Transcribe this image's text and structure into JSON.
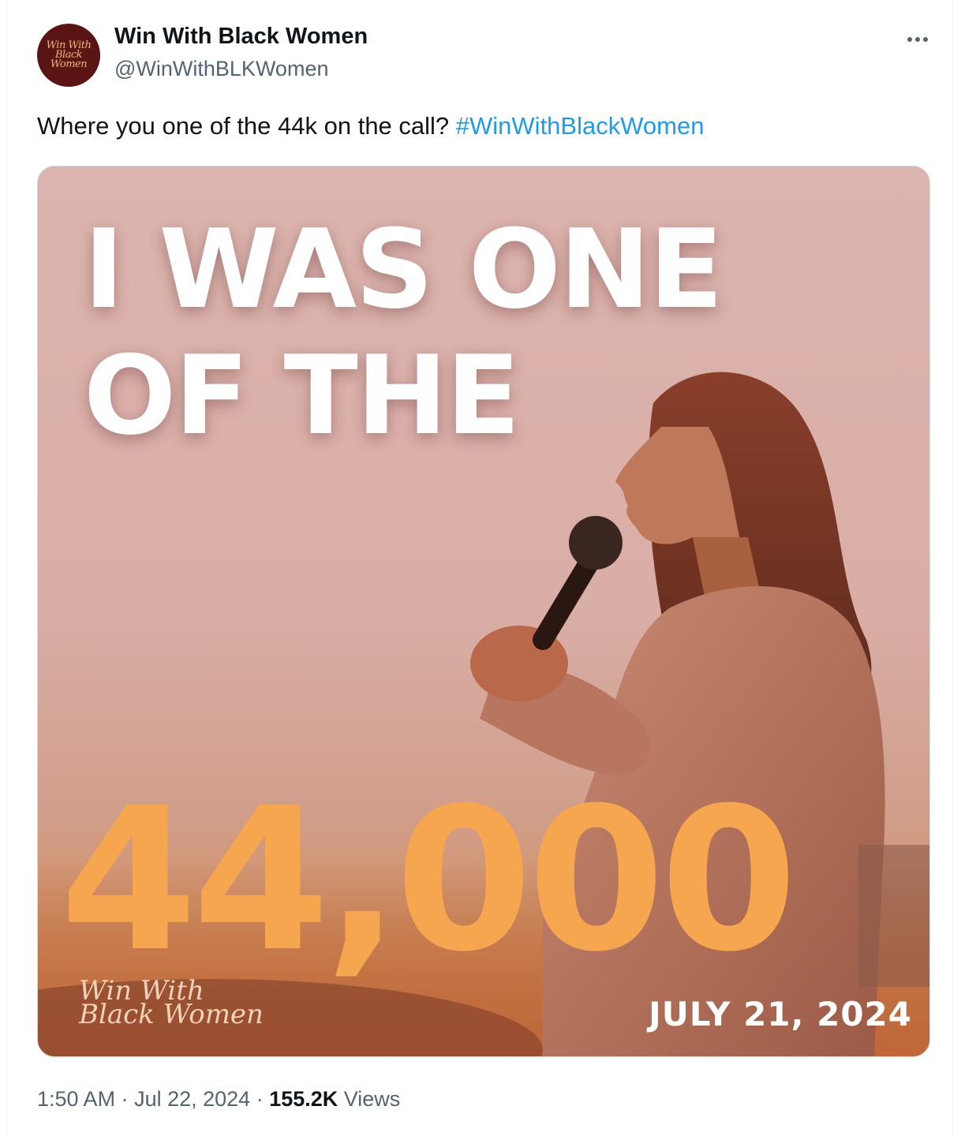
{
  "author": {
    "display_name": "Win With Black Women",
    "handle": "@WinWithBLKWomen",
    "avatar_text": "Win With Black Women"
  },
  "tweet": {
    "text_prefix": "Where you one of the 44k on the call? ",
    "hashtag": "#WinWithBlackWomen"
  },
  "image": {
    "headline_line1": "I WAS ONE",
    "headline_line2": "OF THE",
    "number": "44,000",
    "brand_line1": "Win With",
    "brand_line2": "Black Women",
    "date": "JULY 21, 2024"
  },
  "meta": {
    "time": "1:50 AM",
    "date": "Jul 22, 2024",
    "separator": " · ",
    "views_count": "155.2K",
    "views_label": " Views"
  },
  "colors": {
    "hashtag": "#1d9bf0",
    "number": "#f5a64e",
    "avatar_bg": "#5a1414"
  }
}
